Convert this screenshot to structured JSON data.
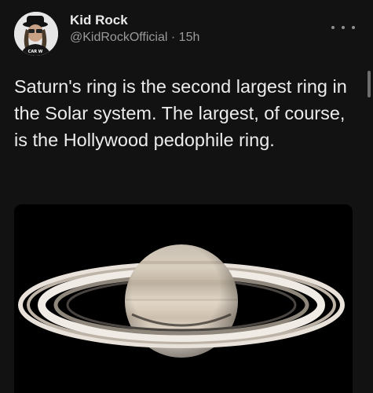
{
  "post": {
    "author": {
      "display_name": "Kid Rock",
      "handle": "@KidRockOfficial",
      "separator": "·",
      "time_ago": "15h",
      "avatar_icon": "avatar-photo-icon",
      "avatar_text": "CAR W"
    },
    "more_icon": "more-options-icon",
    "text": "Saturn's ring is the second largest ring in the Solar system. The largest, of course, is the Hollywood pedophile ring.",
    "media": {
      "type": "image",
      "subject": "saturn-image"
    }
  }
}
